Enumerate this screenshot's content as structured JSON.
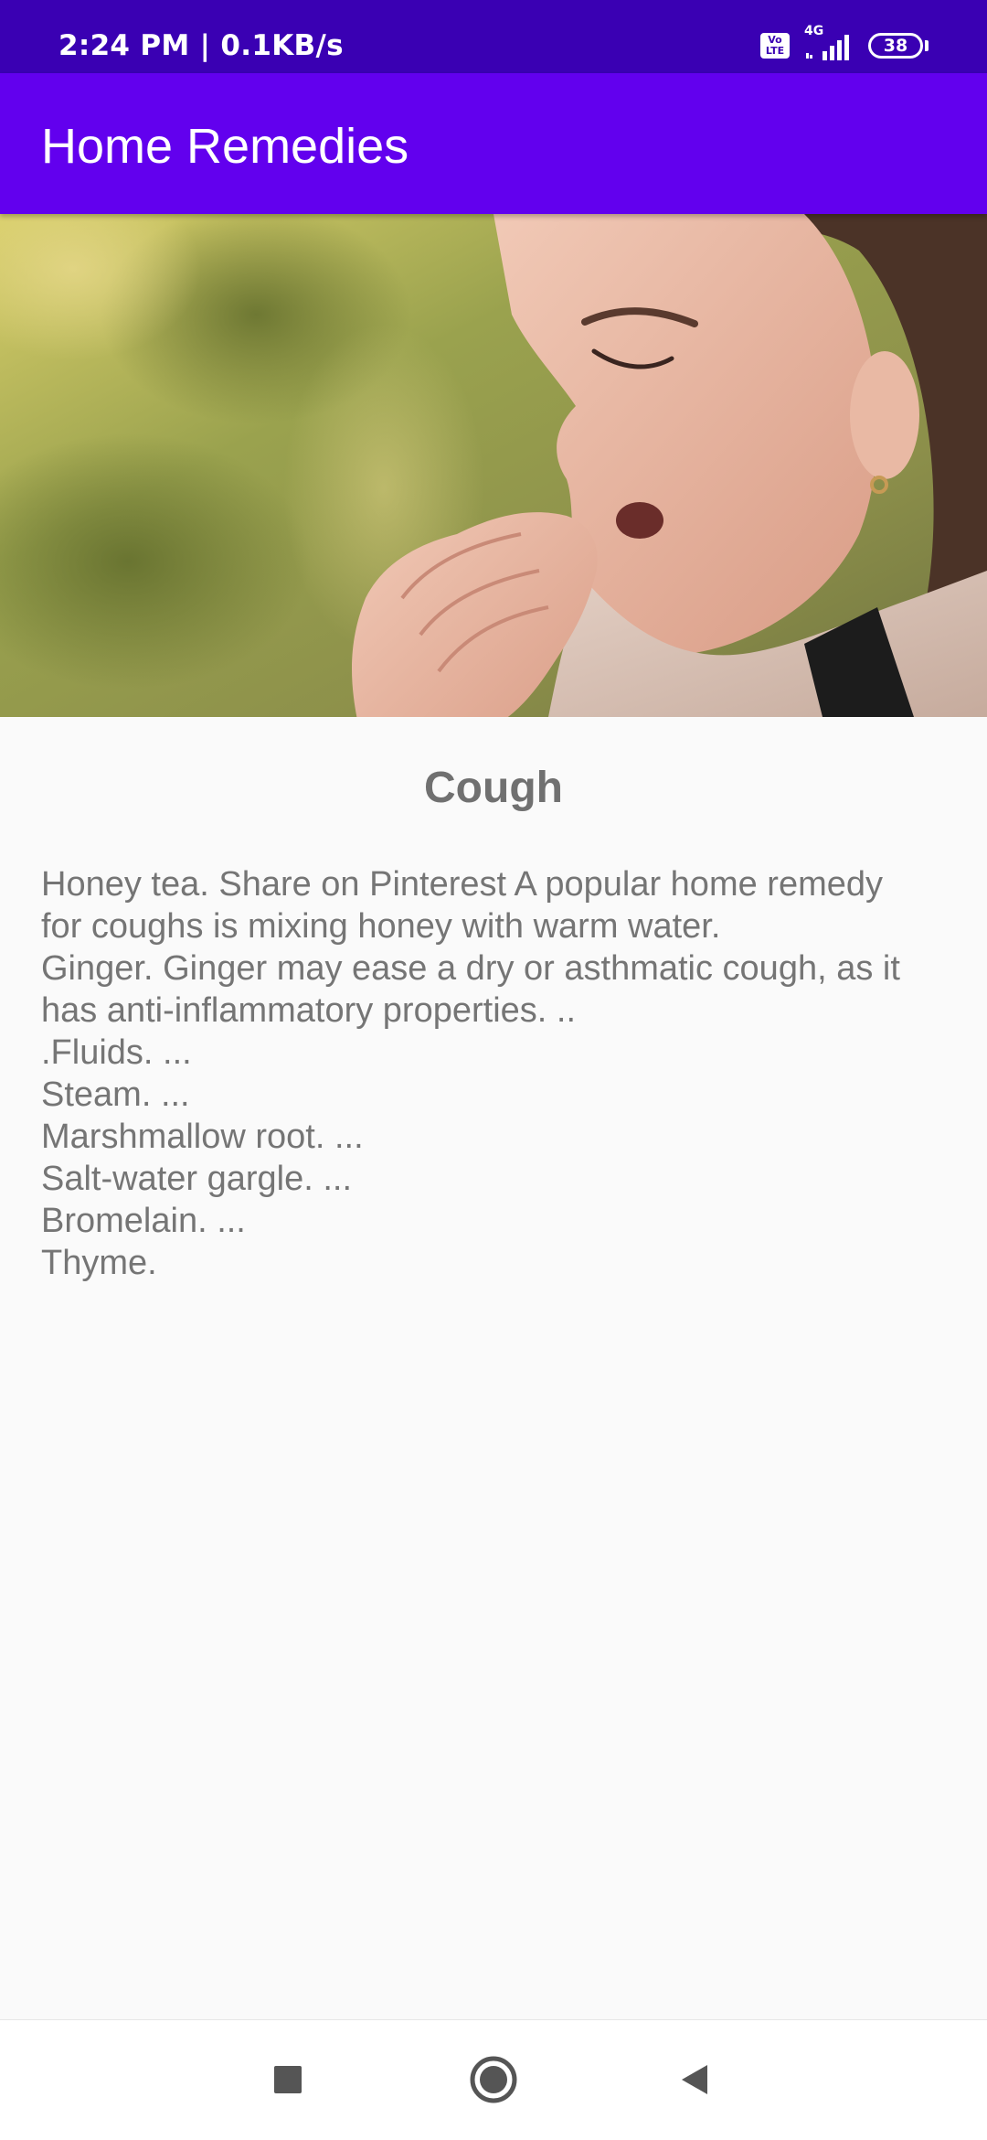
{
  "status_bar": {
    "time_speed": "2:24 PM | 0.1KB/s",
    "volte_line1": "Vo",
    "volte_line2": "LTE",
    "network": "4G",
    "battery": "38"
  },
  "app_bar": {
    "title": "Home Remedies"
  },
  "hero_image": {
    "alt": "woman coughing into hand"
  },
  "content": {
    "title": "Cough",
    "lines": [
      "Honey tea. Share on Pinterest A popular home remedy",
      "for coughs is mixing honey with warm water.",
      "Ginger. Ginger may ease a dry or asthmatic cough, as it",
      "has anti-inflammatory properties. ..",
      ".Fluids. ...",
      "Steam. ...",
      "Marshmallow root. ...",
      "Salt-water gargle. ...",
      "Bromelain. ...",
      "Thyme."
    ]
  },
  "nav_bar": {
    "recents_icon": "square-icon",
    "home_icon": "circle-icon",
    "back_icon": "triangle-icon"
  },
  "colors": {
    "status_bar": "#3a00b3",
    "app_bar": "#6200ee",
    "text": "#757575",
    "title_text": "#707070",
    "background": "#fafafa"
  }
}
